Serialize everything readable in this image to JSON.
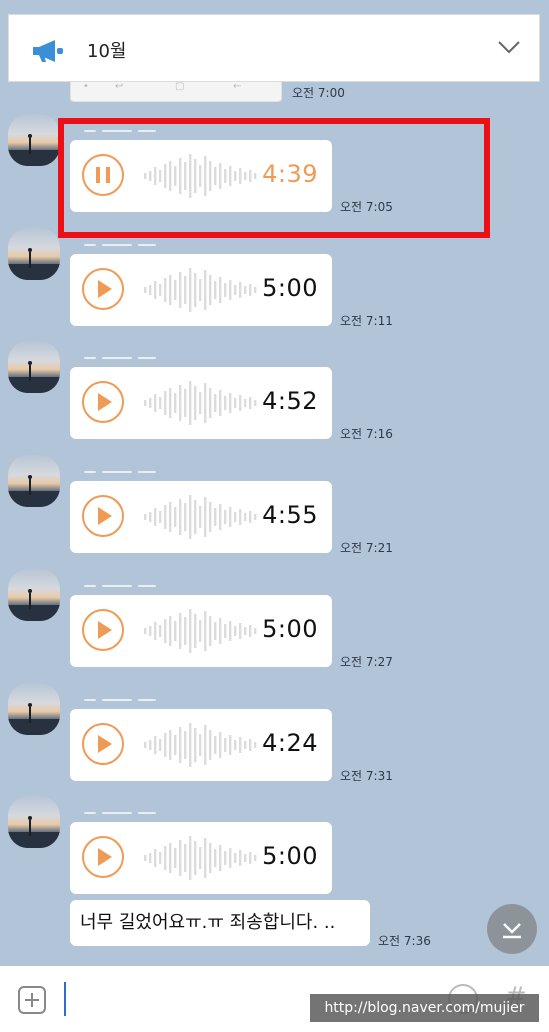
{
  "notice": {
    "title": "10월",
    "megaphone_icon": "megaphone-icon",
    "chevron_icon": "chevron-down-icon"
  },
  "top_message": {
    "time": "오전 7:00"
  },
  "voice_messages": [
    {
      "duration": "4:39",
      "time": "오전 7:05",
      "state": "playing"
    },
    {
      "duration": "5:00",
      "time": "오전 7:11",
      "state": "paused"
    },
    {
      "duration": "4:52",
      "time": "오전 7:16",
      "state": "paused"
    },
    {
      "duration": "4:55",
      "time": "오전 7:21",
      "state": "paused"
    },
    {
      "duration": "5:00",
      "time": "오전 7:27",
      "state": "paused"
    },
    {
      "duration": "4:24",
      "time": "오전 7:31",
      "state": "paused"
    },
    {
      "duration": "5:00",
      "time": "",
      "state": "paused"
    }
  ],
  "text_message": {
    "text": "너무 길었어요ㅠ.ㅠ 죄송합니다. ..",
    "time": "오전 7:36"
  },
  "input_bar": {
    "placeholder": ""
  },
  "watermark": "http://blog.naver.com/mujier",
  "colors": {
    "accent": "#ef9a55",
    "highlight": "#ec0f16",
    "background": "#b1c4d8"
  }
}
